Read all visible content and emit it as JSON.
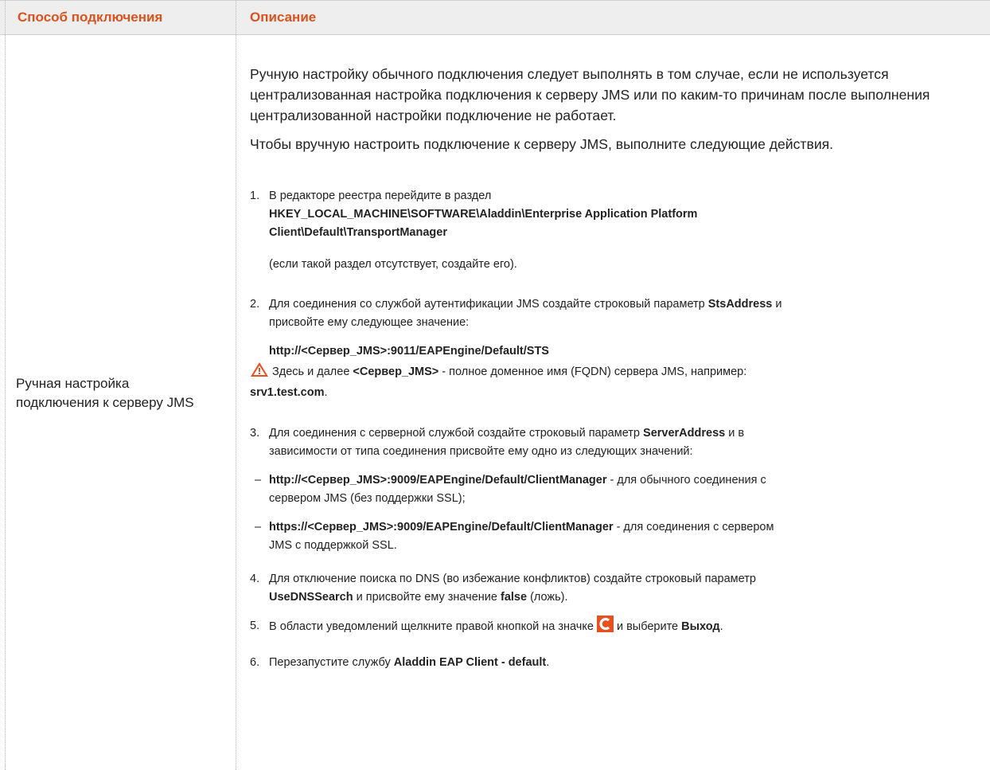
{
  "header": {
    "col1": "Способ подключения",
    "col2": "Описание"
  },
  "left": {
    "method": "Ручная настройка подключения к серверу JMS"
  },
  "intro": {
    "p1": "Ручную настройку обычного подключения следует выполнять в том случае, если не используется централизованная настройка подключения к серверу JMS или по каким-то причинам после выполнения централизованной настройки подключение не работает.",
    "p2": "Чтобы вручную настроить подключение к серверу JMS, выполните следующие действия."
  },
  "steps": {
    "s1": {
      "num": "1.",
      "text": "В редакторе реестра перейдите в раздел",
      "key1": "HKEY_LOCAL_MACHINE\\SOFTWARE\\Aladdin\\Enterprise Application Platform",
      "key2": "Client\\Default\\TransportManager",
      "note": "(если такой раздел отсутствует, создайте его)."
    },
    "s2": {
      "num": "2.",
      "t1": "Для соединения со службой аутентификации JMS создайте строковый параметр ",
      "b1": "StsAddress",
      "t2": " и",
      "t3": "присвойте ему следующее значение:",
      "url": "http://<Сервер_JMS>:9011/EAPEngine/Default/STS",
      "warn_t1": " Здесь и далее ",
      "warn_b1": "<Сервер_JMS>",
      "warn_t2": " - полное доменное имя (FQDN) сервера JMS, например:",
      "warn_b2": "srv1.test.com",
      "warn_t3": "."
    },
    "s3": {
      "num": "3.",
      "t1": "Для соединения с серверной службой создайте строковый параметр ",
      "b1": "ServerAddress",
      "t2": " и в",
      "t3": "зависимости от типа соединения присвойте ему одно из следующих значений:",
      "o1_b": "http://<Сервер_JMS>:9009/EAPEngine/Default/ClientManager",
      "o1_t": " - для обычного соединения с",
      "o1_t2": "сервером JMS (без поддержки SSL);",
      "o2_b": "https://<Сервер_JMS>:9009/EAPEngine/Default/ClientManager",
      "o2_t": " - для соединения с сервером",
      "o2_t2": "JMS с поддержкой SSL.",
      "dash": "–"
    },
    "s4": {
      "num": "4.",
      "t1": "Для отключение поиска по DNS (во избежание конфликтов) создайте строковый параметр",
      "b1": "UseDNSSearch",
      "t2": " и присвойте ему значение ",
      "b2": "false",
      "t3": " (ложь)."
    },
    "s5": {
      "num": "5.",
      "t1": "В области уведомлений щелкните правой кнопкой на значке ",
      "t2": " и выберите ",
      "b1": "Выход",
      "t3": "."
    },
    "s6": {
      "num": "6.",
      "t1": "Перезапустите службу ",
      "b1": "Aladdin EAP Client - default",
      "t2": "."
    }
  },
  "colors": {
    "header_text": "#d9531e",
    "header_bg": "#eeeeee",
    "warning": "#e8501e",
    "app_icon": "#e8501e"
  },
  "icons": {
    "warning": "warning-triangle-icon",
    "app": "aladdin-client-icon"
  }
}
